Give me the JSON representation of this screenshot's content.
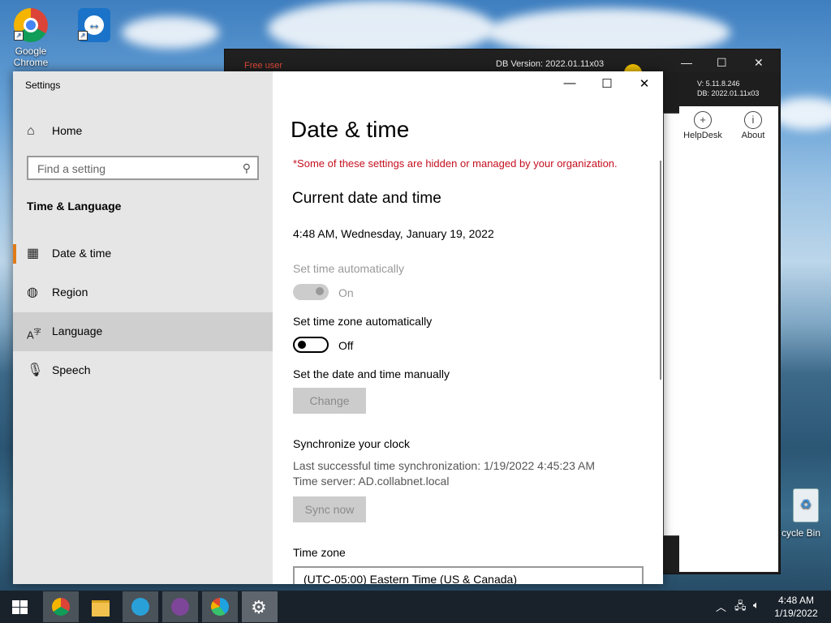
{
  "desktop": {
    "icons": [
      {
        "label": "Google Chrome"
      },
      {
        "label": ""
      }
    ],
    "recycle_bin_label": "cycle Bin"
  },
  "background_app": {
    "user_label": "Free user",
    "db_version": "DB Version: 2022.01.11x03",
    "version_line": "V: 5.11.8.246",
    "db_line": "DB: 2022.01.11x03",
    "buttons": [
      {
        "label": "HelpDesk",
        "icon": "plus-circle-icon"
      },
      {
        "label": "About",
        "icon": "info-icon"
      }
    ]
  },
  "settings": {
    "window_title": "Settings",
    "home_label": "Home",
    "search_placeholder": "Find a setting",
    "section_heading": "Time & Language",
    "nav_items": [
      {
        "label": "Date & time",
        "icon": "calendar-clock-icon",
        "selected": true
      },
      {
        "label": "Region",
        "icon": "globe-icon",
        "selected": false
      },
      {
        "label": "Language",
        "icon": "language-icon",
        "hovered": true
      },
      {
        "label": "Speech",
        "icon": "microphone-icon",
        "selected": false
      }
    ],
    "page_title": "Date & time",
    "managed_warning": "*Some of these settings are hidden or managed by your organization.",
    "current_heading": "Current date and time",
    "current_datetime": "4:48 AM, Wednesday, January 19, 2022",
    "set_time_auto_label": "Set time automatically",
    "set_time_auto_state": "On",
    "set_tz_auto_label": "Set time zone automatically",
    "set_tz_auto_state": "Off",
    "manual_label": "Set the date and time manually",
    "change_button": "Change",
    "sync_heading": "Synchronize your clock",
    "last_sync": "Last successful time synchronization: 1/19/2022 4:45:23 AM",
    "time_server": "Time server: AD.collabnet.local",
    "sync_button": "Sync now",
    "timezone_label": "Time zone",
    "timezone_value": "(UTC-05:00) Eastern Time (US & Canada)"
  },
  "taskbar": {
    "apps": [
      "start",
      "chrome",
      "file-explorer",
      "teamviewer-like",
      "tor-like",
      "edge",
      "settings"
    ],
    "time": "4:48 AM",
    "date": "1/19/2022"
  },
  "colors": {
    "accent": "#e07b18",
    "warning": "#c50f1f",
    "taskbar": "#19222b"
  }
}
